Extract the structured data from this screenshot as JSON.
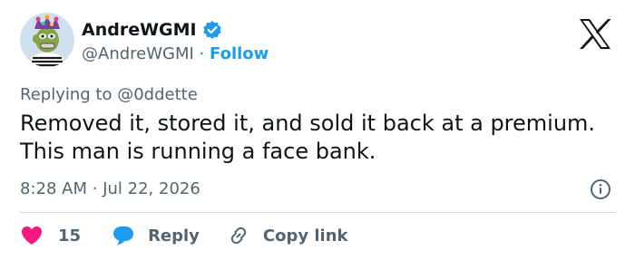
{
  "author": {
    "display_name": "AndreWGMI",
    "handle": "@AndreWGMI",
    "separator": "·",
    "follow_label": "Follow",
    "verified": true,
    "avatar": "bored-ape-avatar"
  },
  "platform_logo": "x-logo",
  "tweet": {
    "replying_to": "Replying to @0ddette",
    "text": "Removed it, stored it, and sold it back at a premium. This man is running a face bank.",
    "time": "8:28 AM",
    "meta_separator": "·",
    "date": "Jul 22, 2026"
  },
  "actions": {
    "like_count": "15",
    "reply_label": "Reply",
    "copy_link_label": "Copy link"
  },
  "colors": {
    "accent": "#1d9bf0",
    "like": "#f91880",
    "secondary_text": "#536471",
    "primary_text": "#0f1419"
  },
  "icons": [
    "heart-icon",
    "reply-bubble-icon",
    "link-icon",
    "info-icon",
    "verified-badge-icon",
    "x-logo"
  ]
}
